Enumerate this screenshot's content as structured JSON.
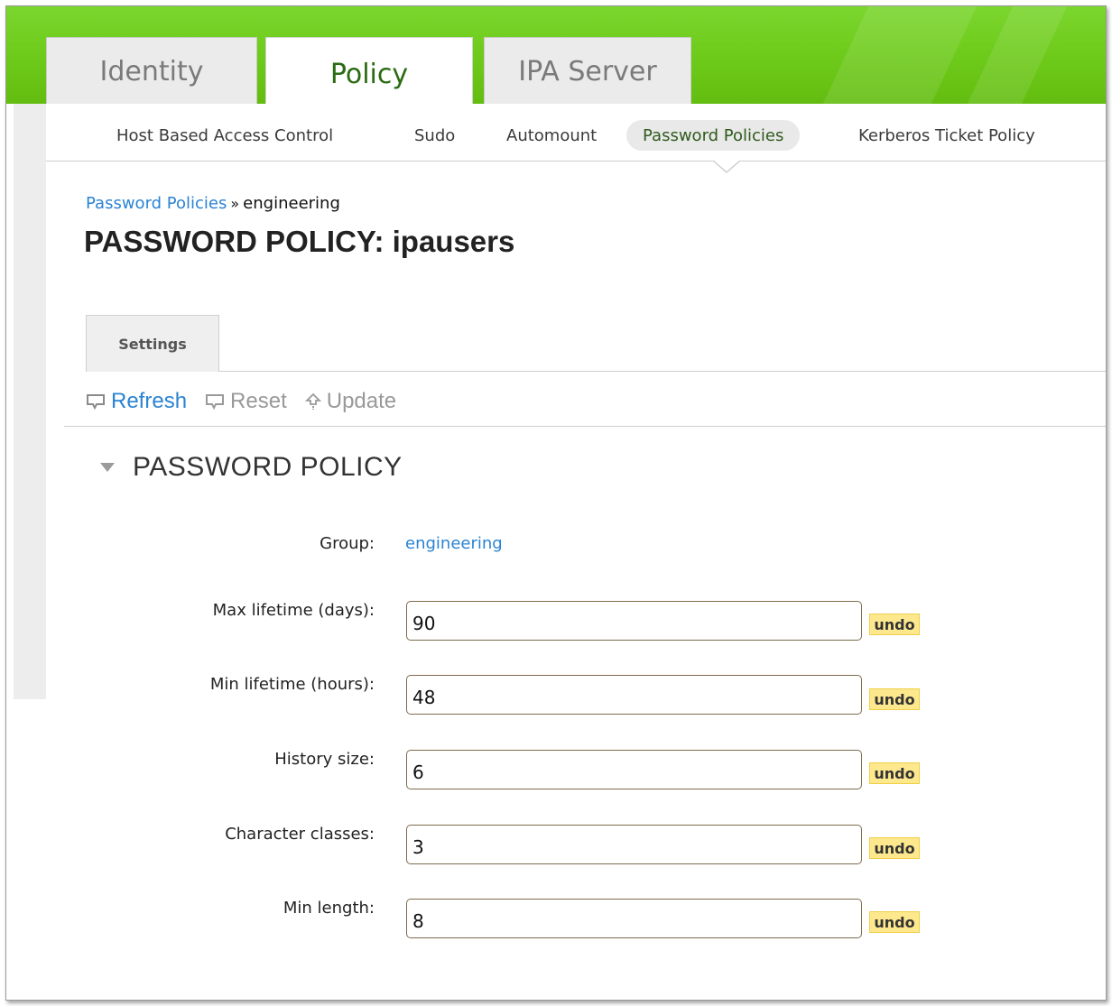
{
  "main_tabs": [
    {
      "label": "Identity",
      "active": false
    },
    {
      "label": "Policy",
      "active": true
    },
    {
      "label": "IPA Server",
      "active": false
    }
  ],
  "sub_nav": [
    {
      "label": "Host Based Access Control",
      "active": false
    },
    {
      "label": "Sudo",
      "active": false
    },
    {
      "label": "Automount",
      "active": false
    },
    {
      "label": "Password Policies",
      "active": true
    },
    {
      "label": "Kerberos Ticket Policy",
      "active": false
    }
  ],
  "breadcrumb": {
    "parent": "Password Policies",
    "separator": "»",
    "current": "engineering"
  },
  "page_title": "PASSWORD POLICY: ipausers",
  "facet_tabs": [
    {
      "label": "Settings"
    }
  ],
  "actions": {
    "refresh": "Refresh",
    "reset": "Reset",
    "update": "Update"
  },
  "section": {
    "title": "PASSWORD POLICY"
  },
  "form": {
    "group": {
      "label": "Group:",
      "value": "engineering"
    },
    "fields": [
      {
        "label": "Max lifetime (days):",
        "value": "90",
        "undo": "undo"
      },
      {
        "label": "Min lifetime (hours):",
        "value": "48",
        "undo": "undo"
      },
      {
        "label": "History size:",
        "value": "6",
        "undo": "undo"
      },
      {
        "label": "Character classes:",
        "value": "3",
        "undo": "undo"
      },
      {
        "label": "Min length:",
        "value": "8",
        "undo": "undo"
      }
    ]
  },
  "colors": {
    "header_green": "#6fcc1c",
    "link_blue": "#2b83d2",
    "undo_bg": "#fde88d",
    "active_tab_text": "#2a6b13"
  },
  "icons": {
    "refresh": "refresh-icon",
    "reset": "reset-icon",
    "update": "update-arrow-icon",
    "collapse": "collapse-triangle-icon"
  }
}
